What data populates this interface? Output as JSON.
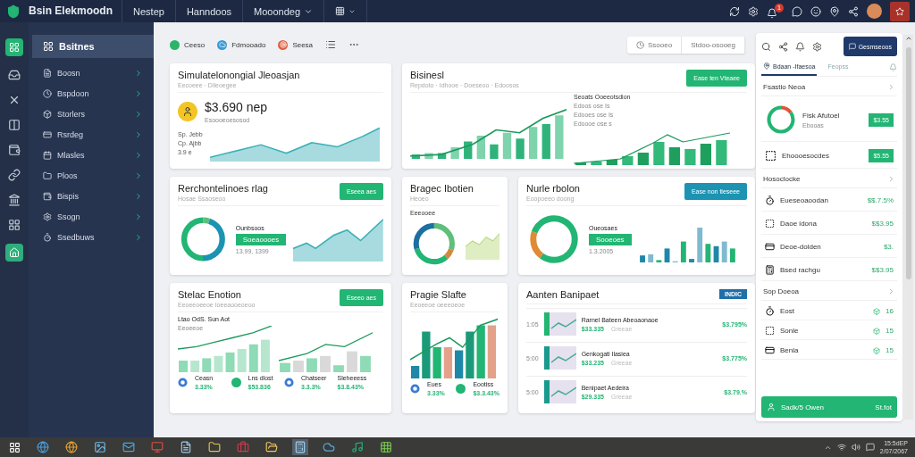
{
  "topbar": {
    "app_name": "Bsin Elekmoodn",
    "menu": [
      {
        "label": "Nestep",
        "dropdown": false
      },
      {
        "label": "Hanndoos",
        "dropdown": false
      },
      {
        "label": "Mooondeg",
        "dropdown": true
      }
    ],
    "notification_count": "1"
  },
  "sidebar": {
    "items": [
      {
        "label": "Bsitnes",
        "selected": true
      },
      {
        "label": "Boosn",
        "selected": false
      },
      {
        "label": "Bspdoon",
        "selected": false
      },
      {
        "label": "Storlers",
        "selected": false
      },
      {
        "label": "Rsrdeg",
        "selected": false
      },
      {
        "label": "Mlasles",
        "selected": false
      },
      {
        "label": "Ploos",
        "selected": false
      },
      {
        "label": "Bispis",
        "selected": false
      },
      {
        "label": "Ssogn",
        "selected": false
      },
      {
        "label": "Ssedbuws",
        "selected": false
      }
    ]
  },
  "toolbar": {
    "filters": [
      {
        "label": "Ceeso",
        "kind": "dot"
      },
      {
        "label": "Fdmooado",
        "kind": "cloud"
      },
      {
        "label": "Seesa",
        "kind": "target"
      }
    ],
    "segments": [
      "Ssooeo",
      "Stdoo-osooeg"
    ]
  },
  "cards": [
    {
      "kind": "metric",
      "title": "Simulatelonongial Jleoasjan",
      "subtitle": "Eecoeee · Dileoegee",
      "value": "$3.690 nep",
      "caption": "Esoooeoesosod",
      "notes": [
        "Sp. Jebb",
        "Cp. Ajbb",
        "3.9 e"
      ]
    },
    {
      "kind": "dual_chart",
      "title": "Bisinesl",
      "subtitle": "Repdoto · Idhooe · Doeseoo · Edoosos",
      "button": {
        "label": "Ease ten Vteaee",
        "color": "#22b573"
      },
      "legend_title": "Seoats Ooeeotsdion",
      "legend": [
        "Edoos ose Is",
        "Edooes ose Is",
        "Edoooe ose s"
      ]
    },
    {
      "kind": "donut_area",
      "title": "Rerchontelinoes rlag",
      "subtitle": "Hosae Ssaoseoo",
      "button": {
        "label": "Eseea aes",
        "color": "#22b573"
      },
      "donut_label": "Ounbsoos",
      "pill": "Soeaoooes",
      "note": "13.99, 1399"
    },
    {
      "kind": "donut_overlay",
      "title": "Bragec Ibotien",
      "subtitle": "Heoeo",
      "note": "Eeeooee"
    },
    {
      "kind": "donut_bars",
      "title": "Nurle rbolon",
      "subtitle": "Eoopoeeo doong",
      "button": {
        "label": "Ease non tieseee",
        "color": "#1c93b2"
      },
      "donut_label": "Oueosaes",
      "pill": "Sooeoes",
      "note": "1.3.2005"
    },
    {
      "kind": "dual_area_legend",
      "title": "Stelac Enotion",
      "subtitle": "Eeoeeoeeoe Ioeeaooeoeoo",
      "button": {
        "label": "Eseeo aes",
        "color": "#22b573"
      },
      "chart_title": "Ltao OdS. Sun Aot",
      "caption": "Eeoeeoe",
      "legend": [
        {
          "kind": "ring",
          "label": "Ceasn",
          "value": "3.33%"
        },
        {
          "kind": "dot",
          "label": "Lns dlost",
          "value": "$53.836"
        },
        {
          "kind": "ring",
          "label": "Chatseer",
          "value": "3.3.3%"
        },
        {
          "kind": "none",
          "label": "Sleheeess",
          "value": "$3.8.43%"
        }
      ]
    },
    {
      "kind": "bars_legend",
      "title": "Pragie Slafte",
      "subtitle": "Eeoeeoe oeeeoeoe",
      "legend": [
        {
          "kind": "ring",
          "label": "Eues",
          "value": "3.33%"
        },
        {
          "kind": "dot",
          "label": "Eootiss",
          "value": "$3.3.43%"
        }
      ]
    },
    {
      "kind": "list",
      "title": "Aanten Banipaet",
      "badge": "INDIC",
      "rows": [
        {
          "time": "1:05",
          "title": "Rarnel Bateen Abeoaonaoe",
          "value": "$33.335",
          "tag": "Greeae",
          "percent": "$3.795%"
        },
        {
          "time": "5:00",
          "title": "Genkogati Ilasiea",
          "value": "$33.235",
          "tag": "Greeae",
          "percent": "$3.775%"
        },
        {
          "time": "5:00",
          "title": "Benipaet Aedeira",
          "value": "$29.335",
          "tag": "Greeae",
          "percent": "$3.79.%"
        }
      ]
    }
  ],
  "right_panel": {
    "action": "Gesmseoos",
    "tabs": [
      {
        "label": "Bdaan -Ifaesoa",
        "selected": true
      },
      {
        "label": "Feopss",
        "selected": false
      }
    ],
    "sections": [
      {
        "kind": "badges",
        "title": "Fsastio Neoa",
        "rows": [
          {
            "label": "Fisk Afutoel",
            "sub": "Ebooas",
            "value": "$3.55"
          },
          {
            "label": "Ehoooesocdes",
            "value": "$5.55"
          }
        ]
      },
      {
        "kind": "plain",
        "title": "Hosoclocke",
        "rows": [
          {
            "label": "Eueseoaoodan",
            "value": "$$.7.5%"
          },
          {
            "label": "Daoe idona",
            "value": "$$3.95"
          },
          {
            "label": "Deoe-dolden",
            "value": "$3."
          },
          {
            "label": "Bsed rachgu",
            "value": "$$3.95"
          }
        ]
      },
      {
        "kind": "count",
        "title": "Sop Doeoa",
        "rows": [
          {
            "label": "Eost",
            "value": "16"
          },
          {
            "label": "Sonle",
            "value": "15"
          },
          {
            "label": "Benla",
            "value": "15"
          }
        ]
      }
    ],
    "footer": {
      "label": "Sadk/5 Owen",
      "value": "St.fot"
    }
  },
  "taskbar": {
    "time": "15:5dEP",
    "date": "2/07/2067"
  }
}
